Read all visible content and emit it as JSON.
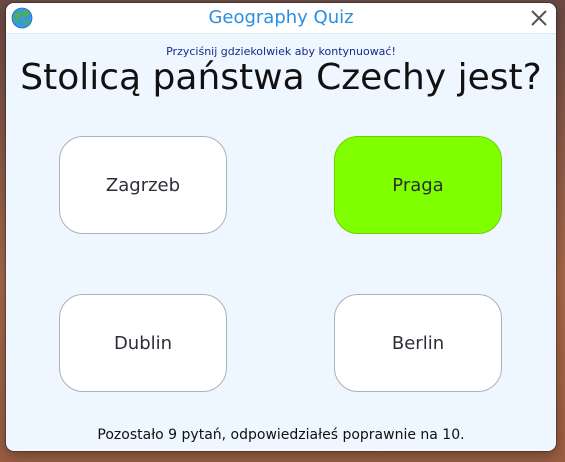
{
  "window": {
    "title": "Geography Quiz",
    "app_icon": "globe-icon",
    "close_icon": "close-icon"
  },
  "quiz": {
    "hint": "Przyciśnij gdziekolwiek aby kontynuować!",
    "question": "Stolicą państwa Czechy jest?",
    "answers": [
      {
        "label": "Zagrzeb",
        "state": "default"
      },
      {
        "label": "Praga",
        "state": "correct"
      },
      {
        "label": "Dublin",
        "state": "default"
      },
      {
        "label": "Berlin",
        "state": "default"
      }
    ],
    "status": "Pozostało 9 pytań, odpowiedziałeś poprawnie na 10."
  },
  "colors": {
    "title_text": "#2b8fe0",
    "correct_answer": "#7fff00",
    "window_background": "#eef6ff",
    "hint_text": "#1a2a8a"
  }
}
